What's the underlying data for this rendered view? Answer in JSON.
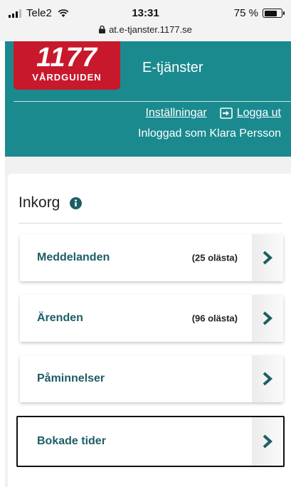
{
  "status_bar": {
    "carrier": "Tele2",
    "time": "13:31",
    "battery_text": "75 %",
    "battery_level": 0.75,
    "url": "at.e-tjanster.1177.se"
  },
  "header": {
    "logo_number": "1177",
    "logo_text": "VÅRDGUIDEN",
    "service_title": "E-tjänster",
    "settings_link": "Inställningar",
    "logout_link": "Logga ut",
    "logged_in_text": "Inloggad som Klara Persson",
    "colors": {
      "teal": "#1a8a8e",
      "logo_red": "#c8182c"
    }
  },
  "inbox": {
    "title": "Inkorg",
    "items": [
      {
        "label": "Meddelanden",
        "count": "(25 olästa)"
      },
      {
        "label": "Ärenden",
        "count": "(96 olästa)"
      },
      {
        "label": "Påminnelser",
        "count": ""
      },
      {
        "label": "Bokade tider",
        "count": ""
      }
    ],
    "accent_color": "#1d5e66"
  },
  "icons": [
    "signal-icon",
    "wifi-icon",
    "battery-icon",
    "lock-icon",
    "logout-icon",
    "info-icon",
    "chevron-right-icon"
  ]
}
